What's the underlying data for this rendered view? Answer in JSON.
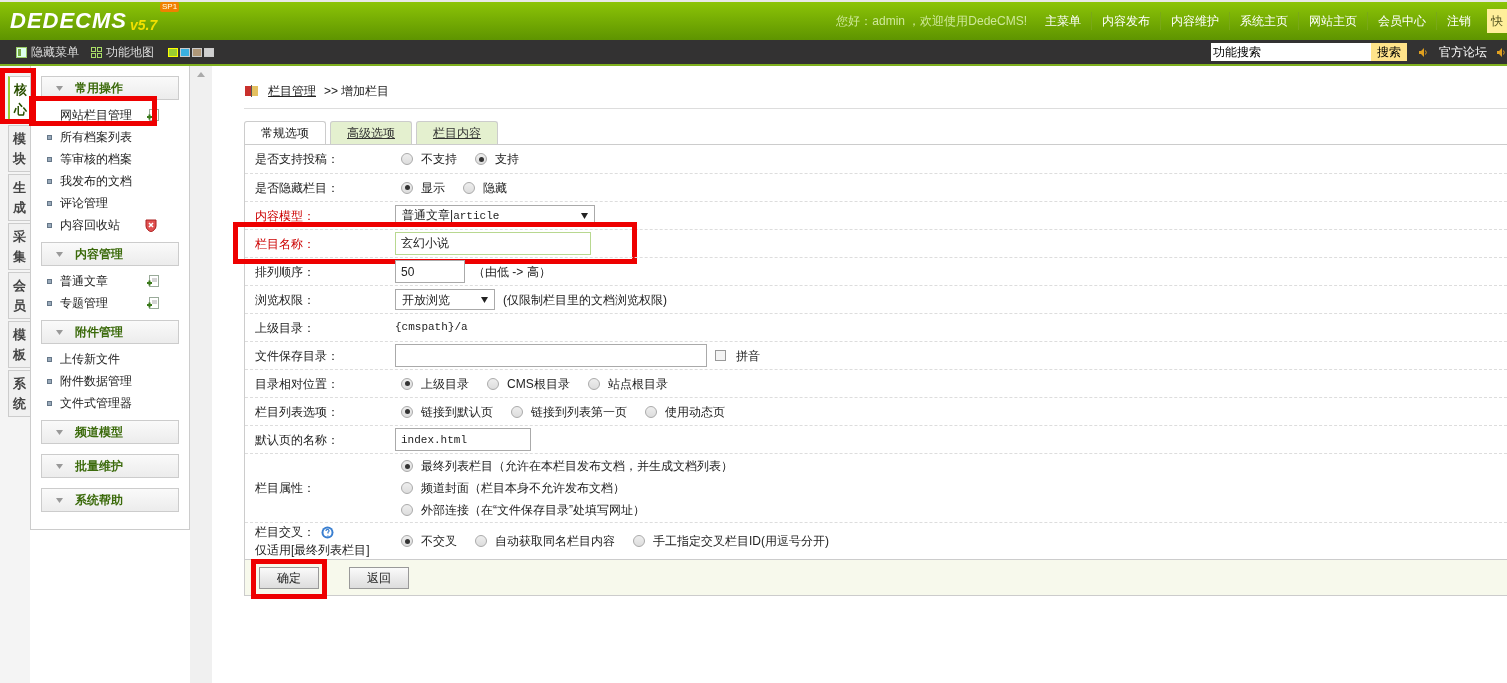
{
  "header": {
    "logo": "DEDECMS",
    "badge": "SP1",
    "version": "v5.7",
    "greeting": "您好：admin ，欢迎使用DedeCMS!",
    "nav": [
      "主菜单",
      "内容发布",
      "内容维护",
      "系统主页",
      "网站主页",
      "会员中心",
      "注销"
    ],
    "quick": "快"
  },
  "toolbar": {
    "items": [
      "隐藏菜单",
      "功能地图"
    ],
    "skins": [
      {
        "color": "#9acd32",
        "selected": true
      },
      {
        "color": "#3ab0e0",
        "selected": false
      },
      {
        "color": "#b09878",
        "selected": false
      },
      {
        "color": "#d0d0d0",
        "selected": false
      }
    ],
    "search_value": "功能搜索",
    "search_button": "搜索",
    "links": [
      "官方论坛"
    ]
  },
  "side_tabs": [
    {
      "label": "核心",
      "selected": true,
      "annotated": true
    },
    {
      "label": "模块",
      "selected": false
    },
    {
      "label": "生成",
      "selected": false
    },
    {
      "label": "采集",
      "selected": false
    },
    {
      "label": "会员",
      "selected": false
    },
    {
      "label": "模板",
      "selected": false
    },
    {
      "label": "系统",
      "selected": false
    }
  ],
  "menu": [
    {
      "title": "常用操作",
      "items": [
        {
          "label": "网站栏目管理",
          "kind": "add",
          "annotated": true
        },
        {
          "label": "所有档案列表",
          "kind": "plain"
        },
        {
          "label": "等审核的档案",
          "kind": "plain"
        },
        {
          "label": "我发布的文档",
          "kind": "plain"
        },
        {
          "label": "评论管理",
          "kind": "plain"
        },
        {
          "label": "内容回收站",
          "kind": "trash"
        }
      ]
    },
    {
      "title": "内容管理",
      "items": [
        {
          "label": "普通文章",
          "kind": "add"
        },
        {
          "label": "专题管理",
          "kind": "add"
        }
      ]
    },
    {
      "title": "附件管理",
      "items": [
        {
          "label": "上传新文件",
          "kind": "plain"
        },
        {
          "label": "附件数据管理",
          "kind": "plain"
        },
        {
          "label": "文件式管理器",
          "kind": "plain"
        }
      ]
    },
    {
      "title": "频道模型"
    },
    {
      "title": "批量维护"
    },
    {
      "title": "系统帮助"
    }
  ],
  "breadcrumb": {
    "link": "栏目管理",
    "current": ">> 增加栏目"
  },
  "tabs": [
    {
      "label": "常规选项",
      "selected": true
    },
    {
      "label": "高级选项",
      "selected": false
    },
    {
      "label": "栏目内容",
      "selected": false
    }
  ],
  "rows": [
    {
      "label": "是否支持投稿：",
      "required": false,
      "controls": [
        {
          "kind": "radio",
          "label": "不支持",
          "checked": false
        },
        {
          "kind": "radio",
          "label": "支持",
          "checked": true
        }
      ]
    },
    {
      "label": "是否隐藏栏目：",
      "required": false,
      "controls": [
        {
          "kind": "radio",
          "label": "显示",
          "checked": true
        },
        {
          "kind": "radio",
          "label": "隐藏",
          "checked": false
        }
      ]
    },
    {
      "label": "内容模型：",
      "required": true,
      "controls": [
        {
          "kind": "select",
          "value": "普通文章|article"
        }
      ]
    },
    {
      "label": "栏目名称：",
      "required": true,
      "annotated": true,
      "controls": [
        {
          "kind": "text",
          "value": "玄幻小说"
        }
      ]
    },
    {
      "label": "排列顺序：",
      "required": false,
      "controls": [
        {
          "kind": "text",
          "value": "50"
        },
        {
          "kind": "note",
          "label": "（由低 -> 高）"
        }
      ]
    },
    {
      "label": "浏览权限：",
      "required": false,
      "controls": [
        {
          "kind": "select",
          "value": "开放浏览"
        },
        {
          "kind": "note",
          "label": "(仅限制栏目里的文档浏览权限)"
        }
      ]
    },
    {
      "label": "上级目录：",
      "required": false,
      "controls": [
        {
          "kind": "static",
          "label": "{cmspath}/a"
        }
      ]
    },
    {
      "label": "文件保存目录：",
      "required": false,
      "controls": [
        {
          "kind": "text"
        },
        {
          "kind": "checkbox",
          "label": "拼音",
          "checked": false
        }
      ]
    },
    {
      "label": "目录相对位置：",
      "required": false,
      "controls": [
        {
          "kind": "radio",
          "label": "上级目录",
          "checked": true
        },
        {
          "kind": "radio",
          "label": "CMS根目录",
          "checked": false
        },
        {
          "kind": "radio",
          "label": "站点根目录",
          "checked": false
        }
      ]
    },
    {
      "label": "栏目列表选项：",
      "required": false,
      "controls": [
        {
          "kind": "radio",
          "label": "链接到默认页",
          "checked": true
        },
        {
          "kind": "radio",
          "label": "链接到列表第一页",
          "checked": false
        },
        {
          "kind": "radio",
          "label": "使用动态页",
          "checked": false
        }
      ]
    },
    {
      "label": "默认页的名称：",
      "required": false,
      "controls": [
        {
          "kind": "text",
          "value": "index.html"
        }
      ]
    },
    {
      "label": "栏目属性：",
      "required": false,
      "stacked": true,
      "controls": [
        {
          "kind": "radio",
          "label": "最终列表栏目（允许在本栏目发布文档，并生成文档列表）",
          "checked": true
        },
        {
          "kind": "radio",
          "label": "频道封面（栏目本身不允许发布文档）",
          "checked": false
        },
        {
          "kind": "radio",
          "label": "外部连接（在“文件保存目录”处填写网址）",
          "checked": false
        }
      ]
    },
    {
      "label": "栏目交叉：",
      "help": true,
      "sublabel": "仅适用[最终列表栏目]",
      "required": false,
      "controls": [
        {
          "kind": "radio",
          "label": "不交叉",
          "checked": true
        },
        {
          "kind": "radio",
          "label": "自动获取同名栏目内容",
          "checked": false
        },
        {
          "kind": "radio",
          "label": "手工指定交叉栏目ID(用逗号分开)",
          "checked": false
        }
      ]
    }
  ],
  "buttons": [
    {
      "label": "确定",
      "annotated": true
    },
    {
      "label": "返回"
    }
  ]
}
